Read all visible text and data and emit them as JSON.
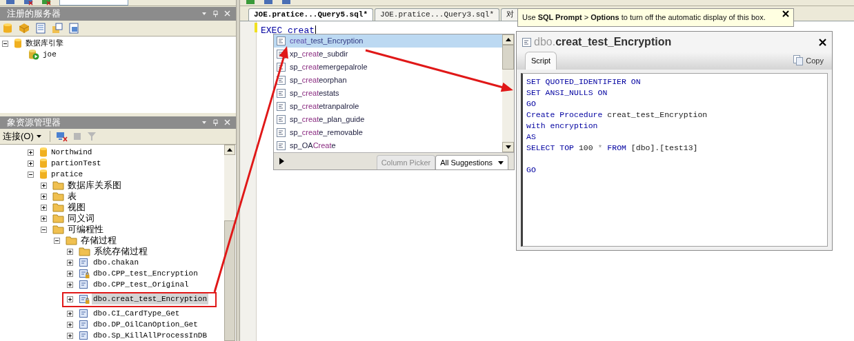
{
  "registered_servers": {
    "title": "注册的服务器",
    "tree": [
      {
        "label": "数据库引擎",
        "kind": "database",
        "expanded": true,
        "children": [
          {
            "label": "joe",
            "kind": "server"
          }
        ]
      }
    ]
  },
  "object_explorer": {
    "title": "象资源管理器",
    "connect_button": "连接(O)",
    "tree": [
      {
        "label": "Northwind",
        "kind": "database",
        "expanded": false
      },
      {
        "label": "partionTest",
        "kind": "database",
        "expanded": false
      },
      {
        "label": "pratice",
        "kind": "database",
        "expanded": true,
        "children": [
          {
            "label": "数据库关系图",
            "kind": "folder",
            "expanded": false
          },
          {
            "label": "表",
            "kind": "folder",
            "expanded": false
          },
          {
            "label": "视图",
            "kind": "folder",
            "expanded": false
          },
          {
            "label": "同义词",
            "kind": "folder",
            "expanded": false
          },
          {
            "label": "可编程性",
            "kind": "folder",
            "expanded": true,
            "children": [
              {
                "label": "存储过程",
                "kind": "folder",
                "expanded": true,
                "children": [
                  {
                    "label": "系统存储过程",
                    "kind": "folder",
                    "expanded": false
                  },
                  {
                    "label": "dbo.chakan",
                    "kind": "procedure",
                    "expanded": false,
                    "locked": false,
                    "selected": false
                  },
                  {
                    "label": "dbo.CPP_test_Encryption",
                    "kind": "procedure",
                    "expanded": false,
                    "locked": true,
                    "selected": false
                  },
                  {
                    "label": "dbo.CPP_test_Original",
                    "kind": "procedure",
                    "expanded": false,
                    "locked": false,
                    "selected": false
                  },
                  {
                    "label": "dbo.creat_test_Encryption",
                    "kind": "procedure",
                    "expanded": false,
                    "locked": true,
                    "selected": true
                  },
                  {
                    "label": "dbo.CI_CardType_Get",
                    "kind": "procedure",
                    "expanded": false,
                    "locked": false,
                    "selected": false
                  },
                  {
                    "label": "dbo.DP_OilCanOption_Get",
                    "kind": "procedure",
                    "expanded": false,
                    "locked": false,
                    "selected": false
                  },
                  {
                    "label": "dbo.Sp_KillAllProcessInDB",
                    "kind": "procedure",
                    "expanded": false,
                    "locked": false,
                    "selected": false
                  }
                ]
              }
            ]
          }
        ]
      }
    ]
  },
  "editor": {
    "tabs": [
      {
        "label": "JOE.pratice...Query5.sql*",
        "selected": true
      },
      {
        "label": "JOE.pratice...Query3.sql*",
        "selected": false
      },
      {
        "label": "对",
        "selected": false
      }
    ],
    "code_line": "EXEC creat"
  },
  "suggestions": {
    "items": [
      {
        "match": "creat",
        "after": "_test_Encryption",
        "selected": true
      },
      {
        "before": "xp_",
        "match": "creat",
        "after": "e_subdir",
        "selected": false
      },
      {
        "before": "sp_",
        "match": "creat",
        "after": "emergepalrole",
        "selected": false
      },
      {
        "before": "sp_",
        "match": "creat",
        "after": "eorphan",
        "selected": false
      },
      {
        "before": "sp_",
        "match": "creat",
        "after": "estats",
        "selected": false
      },
      {
        "before": "sp_",
        "match": "creat",
        "after": "etranpalrole",
        "selected": false
      },
      {
        "before": "sp_",
        "match": "creat",
        "after": "e_plan_guide",
        "selected": false
      },
      {
        "before": "sp_",
        "match": "creat",
        "after": "e_removable",
        "selected": false
      },
      {
        "before": "sp_OA",
        "match": "Creat",
        "after": "e",
        "selected": false
      }
    ],
    "tabs": [
      {
        "label": "Column Picker",
        "selected": false
      },
      {
        "label": "All Suggestions",
        "selected": true
      }
    ]
  },
  "tooltip": "Use **SQL Prompt** > **Options** to turn off the automatic display of this box.",
  "info_popup": {
    "schema": "dbo.",
    "name": "creat_test_Encryption",
    "tab": "Script",
    "copy_button": "Copy",
    "lines": [
      {
        "kind": "code",
        "tokens": [
          {
            "text": "SET QUOTED_IDENTIFIER ON",
            "kind": "keyword"
          }
        ]
      },
      {
        "kind": "code",
        "tokens": [
          {
            "text": "SET ANSI_NULLS ON",
            "kind": "keyword"
          }
        ]
      },
      {
        "kind": "code",
        "tokens": [
          {
            "text": "GO",
            "kind": "keyword"
          }
        ]
      },
      {
        "kind": "code",
        "tokens": [
          {
            "text": "Create Procedure ",
            "kind": "keyword"
          },
          {
            "text": "creat_test_Encryption",
            "kind": "plain"
          }
        ]
      },
      {
        "kind": "code",
        "tokens": [
          {
            "text": "with encryption",
            "kind": "keyword"
          }
        ]
      },
      {
        "kind": "code",
        "tokens": [
          {
            "text": "AS",
            "kind": "keyword"
          }
        ]
      },
      {
        "kind": "code",
        "tokens": [
          {
            "text": "SELECT TOP ",
            "kind": "keyword"
          },
          {
            "text": "100 ",
            "kind": "plain"
          },
          {
            "text": "* ",
            "kind": "operator"
          },
          {
            "text": "FROM ",
            "kind": "keyword"
          },
          {
            "text": "[dbo].[test13]",
            "kind": "plain"
          }
        ]
      },
      {
        "kind": "blank"
      },
      {
        "kind": "code",
        "tokens": [
          {
            "text": "GO",
            "kind": "keyword"
          }
        ]
      }
    ]
  }
}
